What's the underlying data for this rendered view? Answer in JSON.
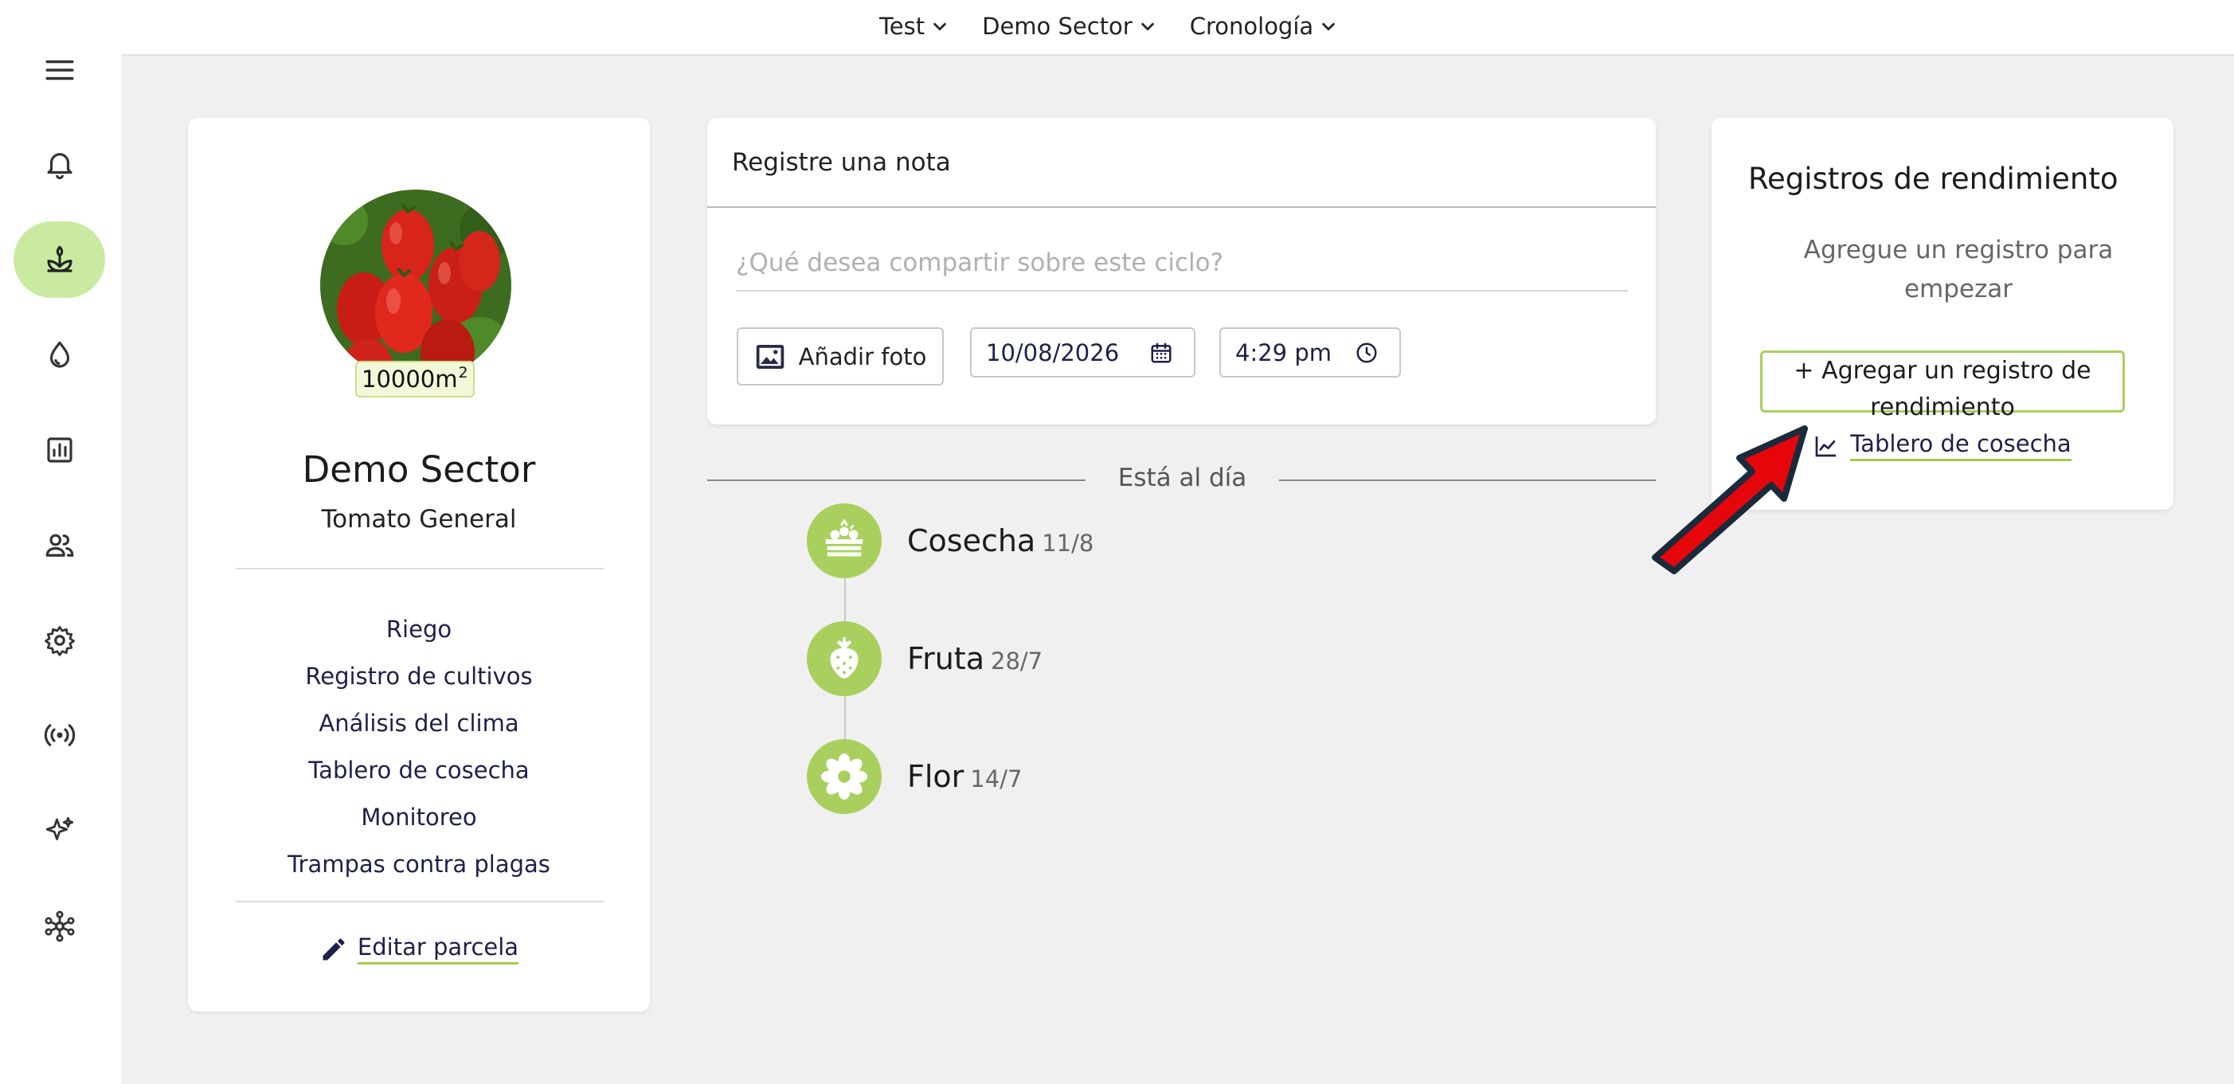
{
  "header": {
    "crumbs": [
      {
        "label": "Test"
      },
      {
        "label": "Demo Sector"
      },
      {
        "label": "Cronología"
      }
    ]
  },
  "sidebar": {
    "items": [
      {
        "icon": "menu-icon"
      },
      {
        "icon": "bell-icon"
      },
      {
        "icon": "plant-icon",
        "active": true
      },
      {
        "icon": "water-drop-icon"
      },
      {
        "icon": "report-chart-icon"
      },
      {
        "icon": "users-icon"
      },
      {
        "icon": "gear-icon"
      },
      {
        "icon": "sensor-signal-icon"
      },
      {
        "icon": "sparkles-icon"
      },
      {
        "icon": "network-icon"
      }
    ]
  },
  "plot": {
    "area_value": "10000m",
    "area_exp": "2",
    "sector_name": "Demo Sector",
    "crop_name": "Tomato General",
    "links": [
      {
        "label": "Riego"
      },
      {
        "label": "Registro de cultivos"
      },
      {
        "label": "Análisis del clima"
      },
      {
        "label": "Tablero de cosecha"
      },
      {
        "label": "Monitoreo"
      },
      {
        "label": "Trampas contra plagas"
      }
    ],
    "edit_label": "Editar parcela"
  },
  "note": {
    "heading": "Registre una nota",
    "placeholder": "¿Qué desea compartir sobre este ciclo?",
    "photo_label": "Añadir foto",
    "date": "10/08/2026",
    "time": "4:29 pm"
  },
  "timeline": {
    "status": "Está al día",
    "events": [
      {
        "title": "Cosecha",
        "date": "11/8",
        "icon": "harvest-crate-icon"
      },
      {
        "title": "Fruta",
        "date": "28/7",
        "icon": "strawberry-icon"
      },
      {
        "title": "Flor",
        "date": "14/7",
        "icon": "flower-icon"
      }
    ]
  },
  "yield": {
    "title": "Registros de rendimiento",
    "hint": "Agregue un registro para empezar",
    "add_label": "+ Agregar un registro de rendimiento",
    "dashboard_label": "Tablero de cosecha"
  },
  "colors": {
    "accent": "#a9d05e",
    "active_bg": "#c9eaa0",
    "link": "#1f1f4b",
    "background": "#f0f0f0",
    "annotation_arrow": "#e5060c"
  }
}
